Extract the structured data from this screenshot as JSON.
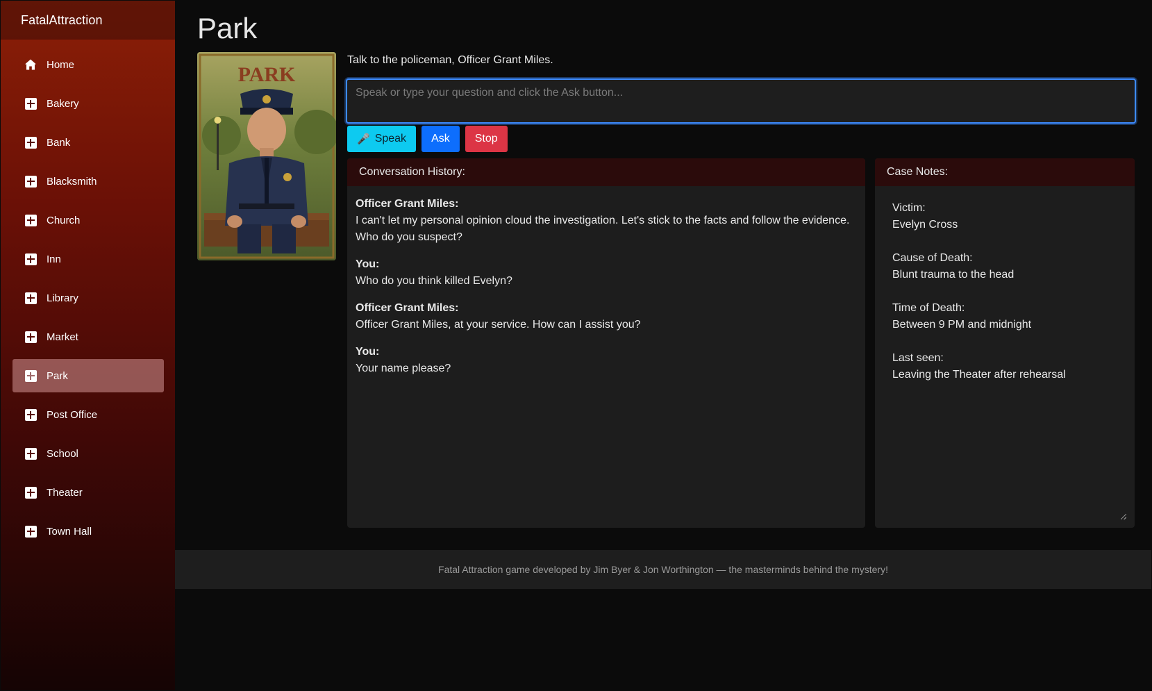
{
  "app": {
    "brand": "FatalAttraction"
  },
  "sidebar": {
    "items": [
      {
        "label": "Home",
        "icon": "home-icon",
        "active": false
      },
      {
        "label": "Bakery",
        "icon": "plus-square-icon",
        "active": false
      },
      {
        "label": "Bank",
        "icon": "plus-square-icon",
        "active": false
      },
      {
        "label": "Blacksmith",
        "icon": "plus-square-icon",
        "active": false
      },
      {
        "label": "Church",
        "icon": "plus-square-icon",
        "active": false
      },
      {
        "label": "Inn",
        "icon": "plus-square-icon",
        "active": false
      },
      {
        "label": "Library",
        "icon": "plus-square-icon",
        "active": false
      },
      {
        "label": "Market",
        "icon": "plus-square-icon",
        "active": false
      },
      {
        "label": "Park",
        "icon": "plus-square-icon",
        "active": true
      },
      {
        "label": "Post Office",
        "icon": "plus-square-icon",
        "active": false
      },
      {
        "label": "School",
        "icon": "plus-square-icon",
        "active": false
      },
      {
        "label": "Theater",
        "icon": "plus-square-icon",
        "active": false
      },
      {
        "label": "Town Hall",
        "icon": "plus-square-icon",
        "active": false
      }
    ]
  },
  "main": {
    "title": "Park",
    "portrait": {
      "sign_text": "PARK"
    },
    "intro": "Talk to the policeman, Officer Grant Miles.",
    "input": {
      "value": "",
      "placeholder": "Speak or type your question and click the Ask button..."
    },
    "buttons": {
      "speak": "Speak",
      "ask": "Ask",
      "stop": "Stop"
    },
    "history": {
      "header": "Conversation History:",
      "messages": [
        {
          "author": "Officer Grant Miles:",
          "text": "I can't let my personal opinion cloud the investigation. Let's stick to the facts and follow the evidence. Who do you suspect?"
        },
        {
          "author": "You:",
          "text": "Who do you think killed Evelyn?"
        },
        {
          "author": "Officer Grant Miles:",
          "text": "Officer Grant Miles, at your service. How can I assist you?"
        },
        {
          "author": "You:",
          "text": "Your name please?"
        }
      ]
    },
    "notes": {
      "header": "Case Notes:",
      "entries": [
        {
          "label": "Victim:",
          "value": "Evelyn Cross"
        },
        {
          "label": "Cause of Death:",
          "value": "Blunt trauma to the head"
        },
        {
          "label": "Time of Death:",
          "value": "Between 9 PM and midnight"
        },
        {
          "label": "Last seen:",
          "value": "Leaving the Theater after rehearsal"
        }
      ]
    }
  },
  "footer": {
    "text": "Fatal Attraction game developed by Jim Byer & Jon Worthington — the masterminds behind the mystery!"
  },
  "colors": {
    "accent": "#3d8bff",
    "speak": "#0dcaf0",
    "ask": "#0d6efd",
    "stop": "#dc3545",
    "panel_header": "#2b0b0b"
  }
}
